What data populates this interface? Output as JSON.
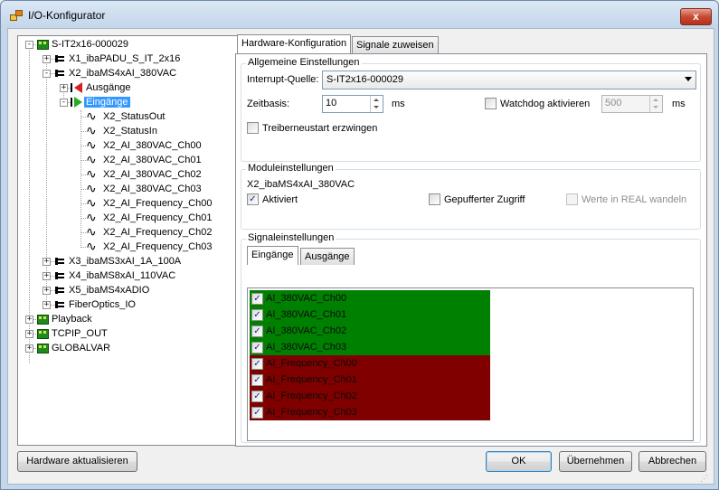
{
  "window": {
    "title": "I/O-Konfigurator",
    "close_glyph": "x"
  },
  "tree": {
    "items": [
      {
        "label": "S-IT2x16-000029",
        "icon": "module-icon",
        "expander": "-"
      },
      {
        "label": "X1_ibaPADU_S_IT_2x16",
        "icon": "connector-icon",
        "expander": "+"
      },
      {
        "label": "X2_ibaMS4xAI_380VAC",
        "icon": "connector-icon",
        "expander": "-"
      },
      {
        "label": "Ausgänge",
        "icon": "output-icon",
        "expander": "+"
      },
      {
        "label": "Eingänge",
        "icon": "input-icon",
        "expander": "-",
        "selected": true
      },
      {
        "label": "X2_StatusOut",
        "icon": "signal-icon"
      },
      {
        "label": "X2_StatusIn",
        "icon": "signal-icon"
      },
      {
        "label": "X2_AI_380VAC_Ch00",
        "icon": "signal-icon"
      },
      {
        "label": "X2_AI_380VAC_Ch01",
        "icon": "signal-icon"
      },
      {
        "label": "X2_AI_380VAC_Ch02",
        "icon": "signal-icon"
      },
      {
        "label": "X2_AI_380VAC_Ch03",
        "icon": "signal-icon"
      },
      {
        "label": "X2_AI_Frequency_Ch00",
        "icon": "signal-icon"
      },
      {
        "label": "X2_AI_Frequency_Ch01",
        "icon": "signal-icon"
      },
      {
        "label": "X2_AI_Frequency_Ch02",
        "icon": "signal-icon"
      },
      {
        "label": "X2_AI_Frequency_Ch03",
        "icon": "signal-icon"
      },
      {
        "label": "X3_ibaMS3xAI_1A_100A",
        "icon": "connector-icon",
        "expander": "+"
      },
      {
        "label": "X4_ibaMS8xAI_110VAC",
        "icon": "connector-icon",
        "expander": "+"
      },
      {
        "label": "X5_ibaMS4xADIO",
        "icon": "connector-icon",
        "expander": "+"
      },
      {
        "label": "FiberOptics_IO",
        "icon": "connector-icon",
        "expander": "+"
      },
      {
        "label": "Playback",
        "icon": "module-icon",
        "expander": "+"
      },
      {
        "label": "TCPIP_OUT",
        "icon": "module-icon",
        "expander": "+"
      },
      {
        "label": "GLOBALVAR",
        "icon": "module-icon",
        "expander": "+"
      }
    ]
  },
  "tabs": [
    {
      "label": "Hardware-Konfiguration",
      "active": true
    },
    {
      "label": "Signale zuweisen",
      "active": false
    }
  ],
  "general": {
    "title": "Allgemeine Einstellungen",
    "interrupt_label": "Interrupt-Quelle:",
    "interrupt_value": "S-IT2x16-000029",
    "timebase_label": "Zeitbasis:",
    "timebase_value": "10",
    "timebase_unit": "ms",
    "watchdog_label": "Watchdog aktivieren",
    "watchdog_checked": false,
    "watchdog_value": "500",
    "watchdog_unit": "ms",
    "driver_restart_label": "Treiberneustart erzwingen",
    "driver_restart_checked": false
  },
  "module": {
    "title": "Moduleinstellungen",
    "name": "X2_ibaMS4xAI_380VAC",
    "activated_label": "Aktiviert",
    "activated_checked": true,
    "buffered_label": "Gepufferter Zugriff",
    "buffered_checked": false,
    "real_label": "Werte in REAL wandeln",
    "real_checked": false
  },
  "signals": {
    "title": "Signaleinstellungen",
    "tabs": [
      {
        "label": "Eingänge",
        "active": true
      },
      {
        "label": "Ausgänge",
        "active": false
      }
    ],
    "rows": [
      {
        "label": "AI_380VAC_Ch00",
        "checked": true,
        "color": "#008000"
      },
      {
        "label": "AI_380VAC_Ch01",
        "checked": true,
        "color": "#008000"
      },
      {
        "label": "AI_380VAC_Ch02",
        "checked": true,
        "color": "#008000"
      },
      {
        "label": "AI_380VAC_Ch03",
        "checked": true,
        "color": "#008000"
      },
      {
        "label": "AI_Frequency_Ch00",
        "checked": true,
        "color": "#800000"
      },
      {
        "label": "AI_Frequency_Ch01",
        "checked": true,
        "color": "#800000"
      },
      {
        "label": "AI_Frequency_Ch02",
        "checked": true,
        "color": "#800000"
      },
      {
        "label": "AI_Frequency_Ch03",
        "checked": true,
        "color": "#800000"
      }
    ]
  },
  "footer": {
    "refresh_label": "Hardware aktualisieren",
    "ok_label": "OK",
    "apply_label": "Übernehmen",
    "cancel_label": "Abbrechen"
  }
}
